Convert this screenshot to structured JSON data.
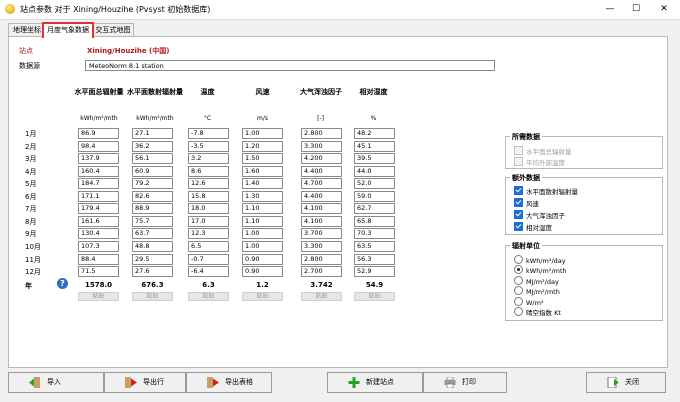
{
  "window": {
    "title": "站点参数 对于 Xining/Houzihe (Pvsyst 初始数据库)",
    "controls": [
      "—",
      "☐",
      "✕"
    ]
  },
  "tabs": [
    {
      "label": "地理坐标",
      "active": false
    },
    {
      "label": "月度气象数据",
      "active": true
    },
    {
      "label": "交互式地图",
      "active": false
    }
  ],
  "station": {
    "label": "站点",
    "value": "Xining/Houzihe  (中国)"
  },
  "source": {
    "label": "数据源",
    "value": "MeteoNorm 8.1 station"
  },
  "columns": [
    {
      "header": "水平面总辐射量",
      "unit": "kWh/m²/mth"
    },
    {
      "header": "水平面散射辐射量",
      "unit": "kWh/m²/mth"
    },
    {
      "header": "温度",
      "unit": "°C"
    },
    {
      "header": "风速",
      "unit": "m/s"
    },
    {
      "header": "大气浑浊因子",
      "unit": "[-]"
    },
    {
      "header": "相对湿度",
      "unit": "%"
    }
  ],
  "months": [
    "1月",
    "2月",
    "3月",
    "4月",
    "5月",
    "6月",
    "7月",
    "8月",
    "9月",
    "10月",
    "11月",
    "12月"
  ],
  "rows": [
    [
      "86.9",
      "27.1",
      "-7.8",
      "1.00",
      "2.800",
      "48.2"
    ],
    [
      "98.4",
      "36.2",
      "-3.5",
      "1.20",
      "3.300",
      "45.1"
    ],
    [
      "137.9",
      "56.1",
      "3.2",
      "1.50",
      "4.200",
      "39.5"
    ],
    [
      "160.4",
      "60.9",
      "8.6",
      "1.60",
      "4.400",
      "44.0"
    ],
    [
      "184.7",
      "79.2",
      "12.6",
      "1.40",
      "4.700",
      "52.0"
    ],
    [
      "171.1",
      "82.6",
      "15.8",
      "1.30",
      "4.400",
      "59.0"
    ],
    [
      "179.4",
      "88.9",
      "18.0",
      "1.10",
      "4.100",
      "62.7"
    ],
    [
      "161.6",
      "75.7",
      "17.0",
      "1.10",
      "4.100",
      "65.8"
    ],
    [
      "130.4",
      "63.7",
      "12.3",
      "1.00",
      "3.700",
      "70.3"
    ],
    [
      "107.3",
      "48.8",
      "6.5",
      "1.00",
      "3.300",
      "63.5"
    ],
    [
      "88.4",
      "29.5",
      "-0.7",
      "0.90",
      "2.800",
      "56.3"
    ],
    [
      "71.5",
      "27.6",
      "-6.4",
      "0.90",
      "2.700",
      "52.9"
    ]
  ],
  "year": {
    "label": "年",
    "values": [
      "1578.0",
      "676.3",
      "6.3",
      "1.2",
      "3.742",
      "54.9"
    ]
  },
  "paste_label": "粘贴",
  "required_data": {
    "title": "所需数据",
    "items": [
      {
        "label": "水平面总辐射量",
        "checked": true,
        "disabled": true
      },
      {
        "label": "平均外部温度",
        "checked": true,
        "disabled": true
      }
    ]
  },
  "extra_data": {
    "title": "额外数据",
    "items": [
      {
        "label": "水平面散射辐射量",
        "checked": true
      },
      {
        "label": "风速",
        "checked": true
      },
      {
        "label": "大气浑浊因子",
        "checked": true
      },
      {
        "label": "相对湿度",
        "checked": true
      }
    ]
  },
  "irradiation_units": {
    "title": "辐射单位",
    "options": [
      {
        "label": "kWh/m²/day",
        "selected": false
      },
      {
        "label": "kWh/m²/mth",
        "selected": true
      },
      {
        "label": "MJ/m²/day",
        "selected": false
      },
      {
        "label": "MJ/m²/mth",
        "selected": false
      },
      {
        "label": "W/m²",
        "selected": false
      },
      {
        "label": "晴空指数 Kt",
        "selected": false
      }
    ]
  },
  "buttons": {
    "import": "导入",
    "export_row": "导出行",
    "export_table": "导出表格",
    "new_station": "新建站点",
    "print": "打印",
    "close": "关闭"
  },
  "colors": {
    "active_tab_border": "#e03030",
    "station_text": "#b01a1a",
    "checkbox": "#1c6fd6",
    "help": "#2f6fc0"
  }
}
